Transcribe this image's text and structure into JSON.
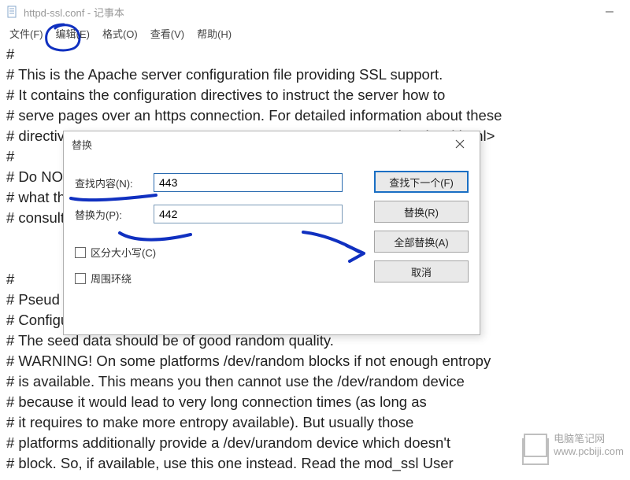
{
  "window": {
    "title": "httpd-ssl.conf - 记事本"
  },
  "menu": {
    "file": "文件(F)",
    "edit": "编辑(E)",
    "format": "格式(O)",
    "view": "查看(V)",
    "help": "帮助(H)"
  },
  "content_lines": [
    "#",
    "# This is the Apache server configuration file providing SSL support.",
    "# It contains the configuration directives to instruct the server how to",
    "# serve pages over an https connection. For detailed information about these",
    "# directive                                                                                /mod_ssl.html>",
    "#",
    "# Do NO                                                                                 nding",
    "# what th                                                                                  are unsure",
    "# consult                                                                                   _",
    "",
    "",
    "#",
    "# Pseud",
    "# Configu                                                                                 ibrary.",
    "# The seed data should be of good random quality.",
    "# WARNING! On some platforms /dev/random blocks if not enough entropy",
    "# is available. This means you then cannot use the /dev/random device",
    "# because it would lead to very long connection times (as long as",
    "# it requires to make more entropy available). But usually those",
    "# platforms additionally provide a /dev/urandom device which doesn't",
    "# block. So, if available, use this one instead. Read the mod_ssl User"
  ],
  "dialog": {
    "title": "替换",
    "find_label": "查找内容(N):",
    "find_value": "443",
    "replace_label": "替换为(P):",
    "replace_value": "442",
    "btn_find_next": "查找下一个(F)",
    "btn_replace": "替换(R)",
    "btn_replace_all": "全部替换(A)",
    "btn_cancel": "取消",
    "chk_case": "区分大小写(C)",
    "chk_wrap": "周围环绕"
  },
  "watermark": {
    "line1": "电脑笔记网",
    "line2": "www.pcbiji.com"
  }
}
